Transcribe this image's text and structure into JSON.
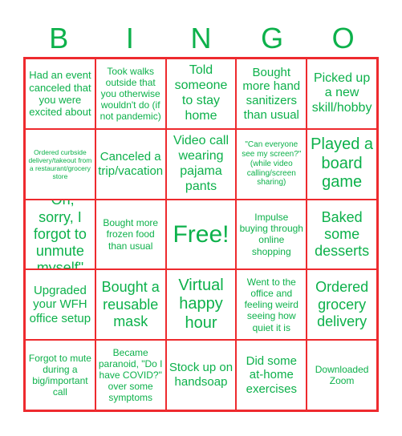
{
  "header": {
    "letters": [
      "B",
      "I",
      "N",
      "G",
      "O"
    ]
  },
  "colors": {
    "text": "#0db14b",
    "grid": "#ee2a2e"
  },
  "cells": [
    [
      "Had an event canceled that you were excited about",
      "Took walks outside that you otherwise wouldn't do (if not pandemic)",
      "Told someone to stay home",
      "Bought more hand sanitizers than usual",
      "Picked up a new skill/hobby"
    ],
    [
      "Ordered curbside delivery/takeout from a restaurant/grocery store",
      "Canceled a trip/vacation",
      "Video call wearing pajama pants",
      "\"Can everyone see my screen?\" (while video calling/screen sharing)",
      "Played a board game"
    ],
    [
      "\"Oh, sorry, I forgot to unmute myself\"",
      "Bought more frozen food than usual",
      "Free!",
      "Impulse buying through online shopping",
      "Baked some desserts"
    ],
    [
      "Upgraded your WFH office setup",
      "Bought a reusable mask",
      "Virtual happy hour",
      "Went to the office and feeling weird seeing how quiet it is",
      "Ordered grocery delivery"
    ],
    [
      "Forgot to mute during a big/important call",
      "Became paranoid, \"Do I have COVID?\" over some symptoms",
      "Stock up on handsoap",
      "Did some at-home exercises",
      "Downloaded Zoom"
    ]
  ]
}
